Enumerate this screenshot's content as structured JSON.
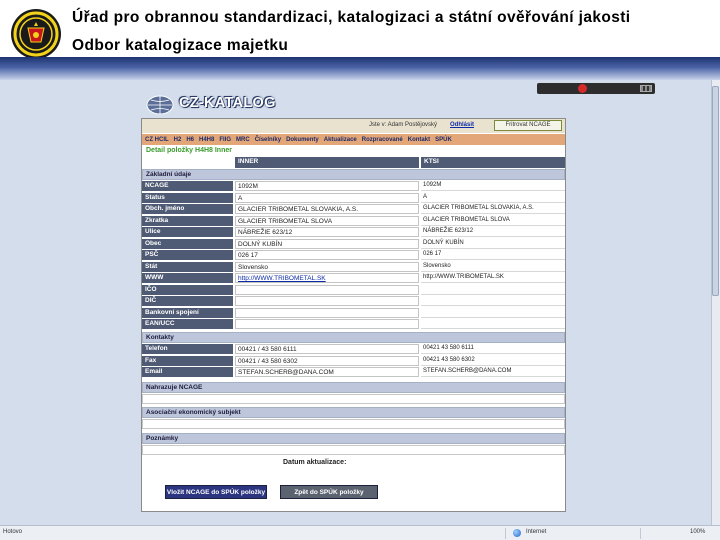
{
  "slide": {
    "title_line1": "Úřad pro obrannou standardizaci, katalogizaci a státní ověřování jakosti",
    "title_line2": "Odbor katalogizace majetku"
  },
  "colors": {
    "header_band": "#1e3270",
    "browser_bg": "#d3ddeb",
    "label_cell": "#4f5a74",
    "section_head": "#bdc6da",
    "menu_bar": "#e3a679",
    "detail_title": "#3a9a2c",
    "button_primary": "#2b3580",
    "button_secondary": "#5b6270"
  },
  "app": {
    "logo_text": "CZ-KATALOG",
    "user_label": "Jste v: Adam Postějovský",
    "logout_label": "Odhlásit",
    "filter_label": "Fritrovat NCAGE",
    "menu": [
      "CZ HCIL",
      "H2",
      "H6",
      "H4H8",
      "FIIG",
      "MRC",
      "Číselníky",
      "Dokumenty",
      "Aktualizace",
      "Rozpracované",
      "Kontakt",
      "SPÚK"
    ],
    "detail_title": "Detail položky H4H8 Inner",
    "col_headers": {
      "inner": "INNER",
      "ktsi": "KTSI"
    },
    "sections": {
      "basic": "Základní údaje",
      "contacts": "Kontakty",
      "parent_ncage": "Nahrazuje NCAGE",
      "associated": "Asociační ekonomický subjekt",
      "notes": "Poznámky"
    },
    "basic_rows": [
      {
        "label": "NCAGE",
        "inner": "1092M",
        "ktsi": "1092M"
      },
      {
        "label": "Status",
        "inner": "A",
        "ktsi": "A"
      },
      {
        "label": "Obch. jméno",
        "inner": "GLACIER TRIBOMETAL SLOVAKIA, A.S.",
        "ktsi": "GLACIER TRIBOMETAL SLOVAKIA, A.S."
      },
      {
        "label": "Zkratka",
        "inner": "GLACIER TRIBOMETAL SLOVA",
        "ktsi": "GLACIER TRIBOMETAL SLOVA"
      },
      {
        "label": "Ulice",
        "inner": "NÁBREŽIE 623/12",
        "ktsi": "NÁBREŽIE 623/12"
      },
      {
        "label": "Obec",
        "inner": "DOLNÝ KUBÍN",
        "ktsi": "DOLNÝ KUBÍN"
      },
      {
        "label": "PSČ",
        "inner": "026 17",
        "ktsi": "026 17"
      },
      {
        "label": "Stát",
        "inner": "Slovensko",
        "ktsi": "Slovensko"
      },
      {
        "label": "WWW",
        "inner": "http://WWW.TRIBOMETAL.SK",
        "ktsi": "http://WWW.TRIBOMETAL.SK"
      },
      {
        "label": "IČO",
        "inner": "",
        "ktsi": ""
      },
      {
        "label": "DIČ",
        "inner": "",
        "ktsi": ""
      },
      {
        "label": "Bankovní spojení",
        "inner": "",
        "ktsi": ""
      },
      {
        "label": "EAN/UCC",
        "inner": "",
        "ktsi": ""
      }
    ],
    "contact_rows": [
      {
        "label": "Telefon",
        "inner": "00421 / 43 580 6111",
        "ktsi": "00421 43 580 6111"
      },
      {
        "label": "Fax",
        "inner": "00421 / 43 580 6302",
        "ktsi": "00421 43 580 6302"
      },
      {
        "label": "Email",
        "inner": "STEFAN.SCHERB@DANA.COM",
        "ktsi": "STEFAN.SCHERB@DANA.COM"
      }
    ],
    "date_label": "Datum aktualizace:",
    "button_send": "Vložit NCAGE do SPÚK položky",
    "button_back": "Zpět do SPÚK položky"
  },
  "statusbar": {
    "left": "Hotovo",
    "zone": "Internet",
    "zoom": "100%"
  }
}
